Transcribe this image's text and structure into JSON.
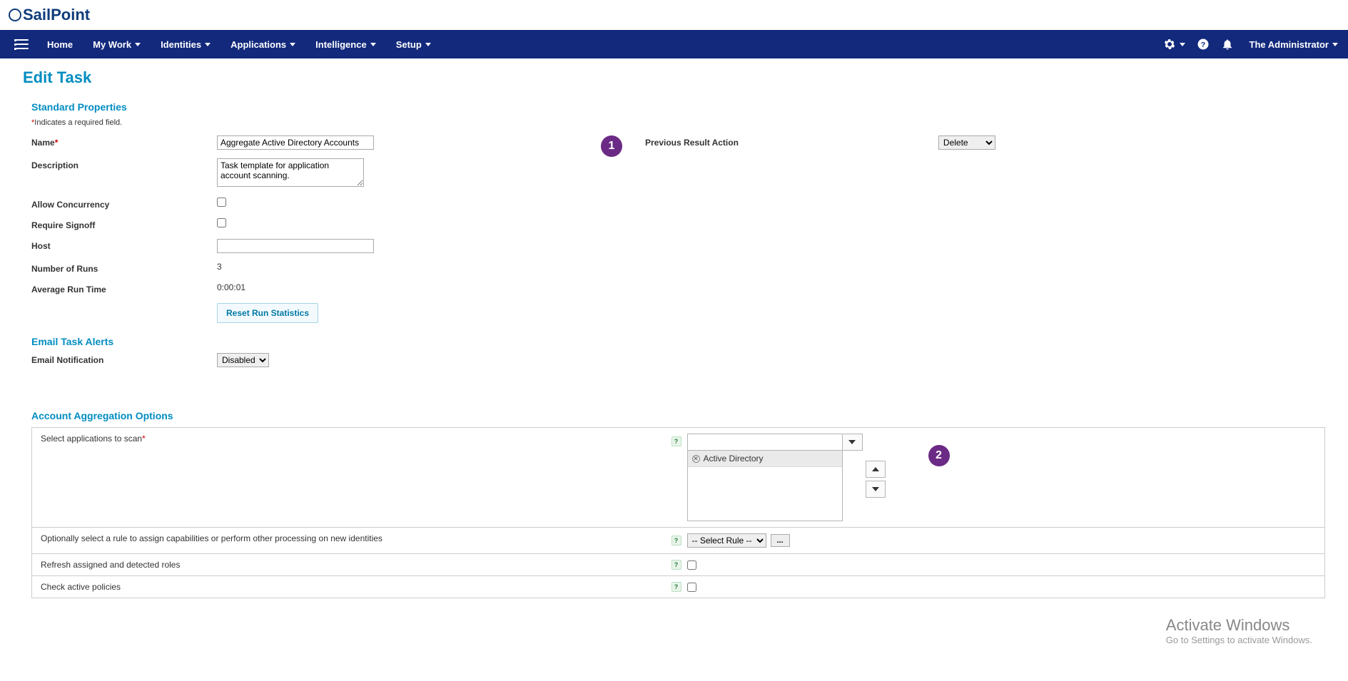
{
  "brand": "SailPoint",
  "nav": {
    "items": [
      {
        "label": "Home",
        "hasCaret": false
      },
      {
        "label": "My Work",
        "hasCaret": true
      },
      {
        "label": "Identities",
        "hasCaret": true
      },
      {
        "label": "Applications",
        "hasCaret": true
      },
      {
        "label": "Intelligence",
        "hasCaret": true
      },
      {
        "label": "Setup",
        "hasCaret": true
      }
    ],
    "user": "The Administrator"
  },
  "page": {
    "title": "Edit Task"
  },
  "required_note": "*Indicates a required field.",
  "standard": {
    "title": "Standard Properties",
    "name_label": "Name",
    "name_value": "Aggregate Active Directory Accounts",
    "prev_result_label": "Previous Result Action",
    "prev_result_value": "Delete",
    "desc_label": "Description",
    "desc_value": "Task template for application account scanning.",
    "allow_concurrency_label": "Allow Concurrency",
    "require_signoff_label": "Require Signoff",
    "host_label": "Host",
    "host_value": "",
    "num_runs_label": "Number of Runs",
    "num_runs_value": "3",
    "avg_runtime_label": "Average Run Time",
    "avg_runtime_value": "0:00:01",
    "reset_button": "Reset Run Statistics"
  },
  "email_alerts": {
    "title": "Email Task Alerts",
    "email_notification_label": "Email Notification",
    "email_notification_value": "Disabled"
  },
  "aggregation": {
    "title": "Account Aggregation Options",
    "select_apps_label": "Select applications to scan",
    "selected_app": "Active Directory",
    "rule_label": "Optionally select a rule to assign capabilities or perform other processing on new identities",
    "rule_value": "-- Select Rule --",
    "refresh_roles_label": "Refresh assigned and detected roles",
    "check_policies_label": "Check active policies"
  },
  "callouts": {
    "c1": "1",
    "c2": "2"
  },
  "watermark": {
    "title": "Activate Windows",
    "sub": "Go to Settings to activate Windows."
  }
}
